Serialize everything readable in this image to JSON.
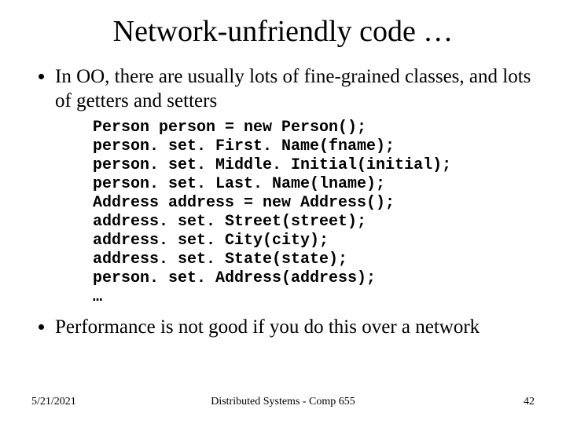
{
  "title": "Network-unfriendly code …",
  "bullets": {
    "b1": "In OO, there are usually lots of fine-grained classes, and lots of getters and setters",
    "b2": "Performance is not good if you do this over a network"
  },
  "code": "Person person = new Person();\nperson. set. First. Name(fname);\nperson. set. Middle. Initial(initial);\nperson. set. Last. Name(lname);\nAddress address = new Address();\naddress. set. Street(street);\naddress. set. City(city);\naddress. set. State(state);\nperson. set. Address(address);\n…",
  "footer": {
    "date": "5/21/2021",
    "center": "Distributed Systems - Comp 655",
    "page": "42"
  }
}
